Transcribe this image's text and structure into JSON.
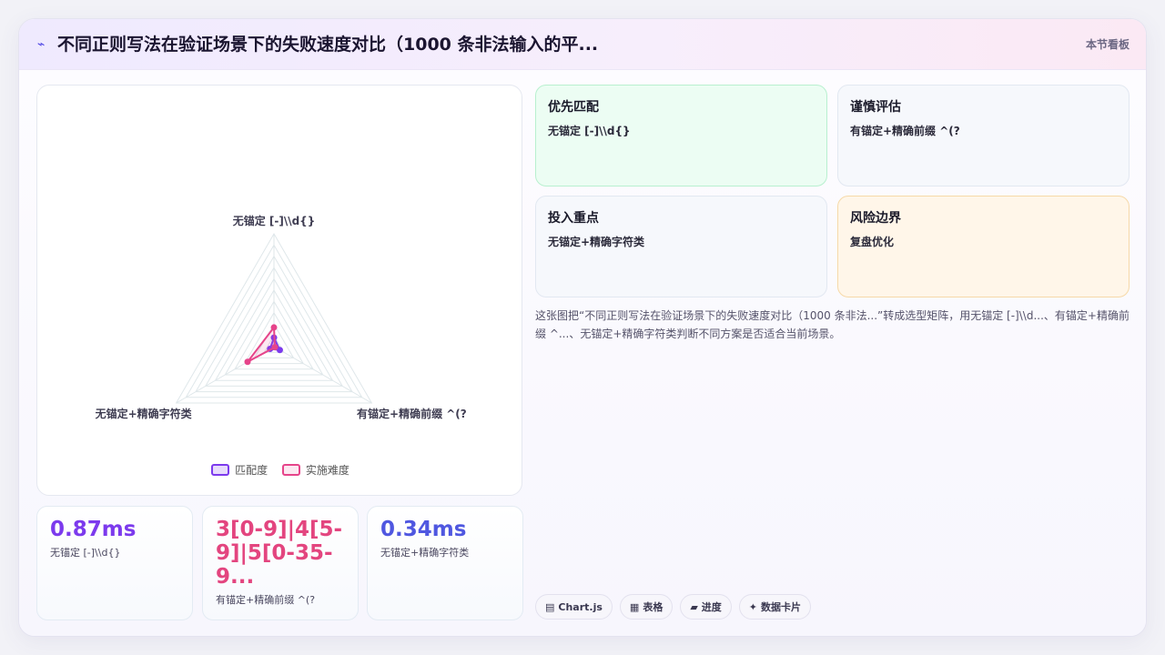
{
  "header": {
    "icon": "chart-spark-icon",
    "title": "不同正则写法在验证场景下的失败速度对比（1000 条非法输入的平...",
    "right_label": "本节看板"
  },
  "chart_data": {
    "type": "radar",
    "axes": [
      "无锚定 [-]\\\\d{}",
      "有锚定+精确前缀 ^(?",
      "无锚定+精确字符类"
    ],
    "rmax": 10,
    "grid_levels": 10,
    "series": [
      {
        "name": "匹配度",
        "color": "#7c3aed",
        "values": [
          0.8,
          0.6,
          0.4
        ]
      },
      {
        "name": "实施难度",
        "color": "#e6448a",
        "values": [
          1.7,
          0.1,
          2.7
        ]
      }
    ],
    "legend_position": "bottom"
  },
  "stats": [
    {
      "value": "0.87ms",
      "label": "无锚定 [-]\\\\d{}"
    },
    {
      "value": "3[0-9]|4[5-9]|5[0-35-9...",
      "label": "有锚定+精确前缀 ^(?"
    },
    {
      "value": "0.34ms",
      "label": "无锚定+精确字符类"
    }
  ],
  "cards": [
    {
      "title": "优先匹配",
      "text": "无锚定 [-]\\\\d{}"
    },
    {
      "title": "谨慎评估",
      "text": "有锚定+精确前缀 ^(?"
    },
    {
      "title": "投入重点",
      "text": "无锚定+精确字符类"
    },
    {
      "title": "风险边界",
      "text": "复盘优化"
    }
  ],
  "description": "这张图把“不同正则写法在验证场景下的失败速度对比（1000 条非法...”转成选型矩阵，用无锚定 [-]\\\\d...、有锚定+精确前缀 ^...、无锚定+精确字符类判断不同方案是否适合当前场景。",
  "chips": [
    {
      "icon": "▤",
      "label": "Chart.js"
    },
    {
      "icon": "▦",
      "label": "表格"
    },
    {
      "icon": "▰",
      "label": "进度"
    },
    {
      "icon": "✦",
      "label": "数据卡片"
    }
  ]
}
